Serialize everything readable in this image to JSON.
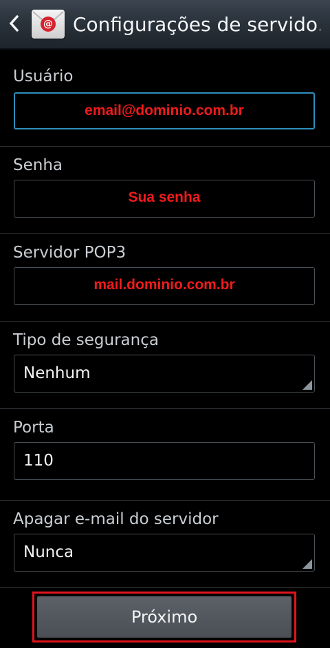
{
  "header": {
    "title": "Configurações de servido…",
    "back_icon": "chevron-left-icon",
    "app_icon": "email-app-icon"
  },
  "fields": {
    "username": {
      "label": "Usuário",
      "placeholder": "email@dominio.com.br"
    },
    "password": {
      "label": "Senha",
      "placeholder": "Sua senha"
    },
    "server": {
      "label": "Servidor POP3",
      "placeholder": "mail.dominio.com.br"
    },
    "security": {
      "label": "Tipo de segurança",
      "value": "Nenhum"
    },
    "port": {
      "label": "Porta",
      "value": "110"
    },
    "delete": {
      "label": "Apagar e-mail do servidor",
      "value": "Nunca"
    }
  },
  "footer": {
    "next_label": "Próximo"
  },
  "colors": {
    "hint_text": "#f01b1b",
    "focus_border": "#2e8fbf",
    "highlight_outline": "#e2141b"
  }
}
